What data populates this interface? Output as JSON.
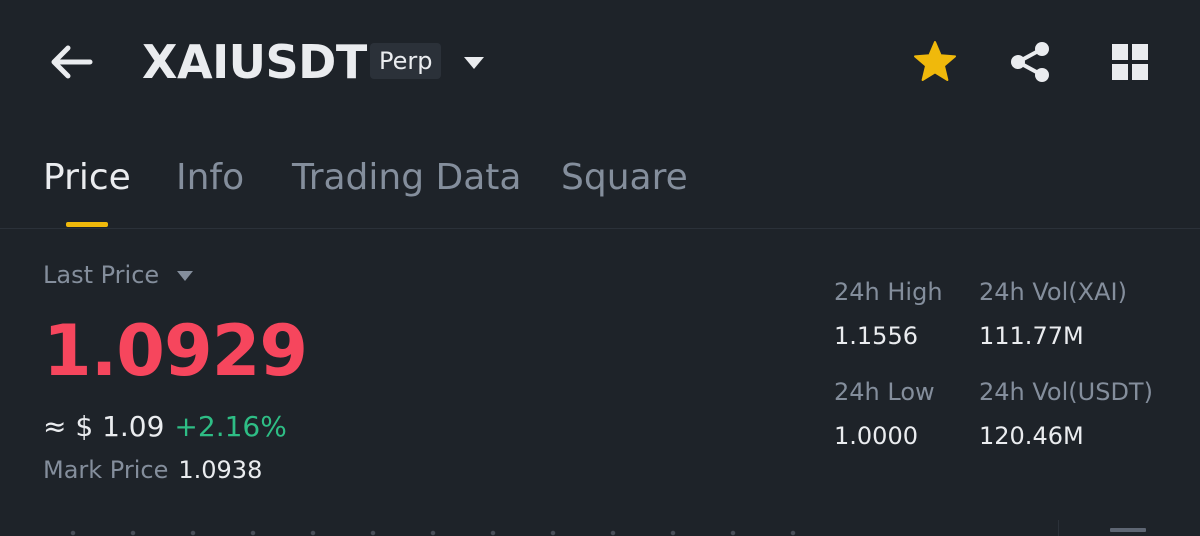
{
  "header": {
    "symbol": "XAIUSDT",
    "contract_type": "Perp",
    "back_icon": "arrow-left-icon",
    "favorite_icon": "star-icon",
    "share_icon": "share-icon",
    "menu_icon": "grid-icon",
    "favorite_color": "#f0b90b"
  },
  "tabs": [
    {
      "label": "Price",
      "active": true
    },
    {
      "label": "Info",
      "active": false
    },
    {
      "label": "Trading Data",
      "active": false
    },
    {
      "label": "Square",
      "active": false
    }
  ],
  "price": {
    "selector_label": "Last Price",
    "last_price": "1.0929",
    "usd_approx": "≈ $ 1.09",
    "change_pct": "+2.16%",
    "mark_price_label": "Mark Price",
    "mark_price": "1.0938"
  },
  "stats": {
    "high_label": "24h High",
    "high_value": "1.1556",
    "vol_base_label": "24h Vol(XAI)",
    "vol_base_value": "111.77M",
    "low_label": "24h Low",
    "low_value": "1.0000",
    "vol_quote_label": "24h Vol(USDT)",
    "vol_quote_value": "120.46M"
  },
  "colors": {
    "background": "#1e2329",
    "accent": "#f0b90b",
    "down": "#f6465d",
    "up": "#2ebd85",
    "muted_text": "#848e9c",
    "primary_text": "#eaecef"
  }
}
